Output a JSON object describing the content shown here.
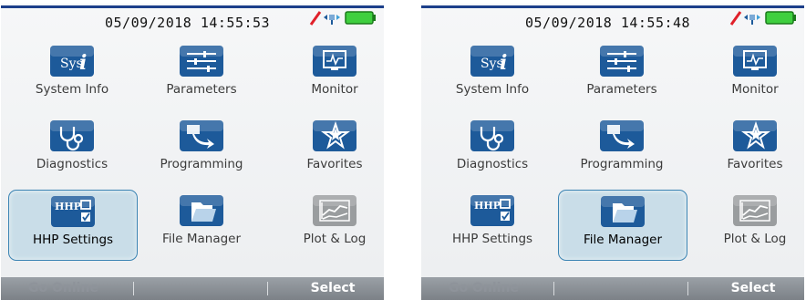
{
  "screens": [
    {
      "datetime": "05/09/2018  14:55:53",
      "selected_index": 6,
      "menu": [
        {
          "label": "System Info",
          "icon": "system-info-icon"
        },
        {
          "label": "Parameters",
          "icon": "parameters-icon"
        },
        {
          "label": "Monitor",
          "icon": "monitor-icon"
        },
        {
          "label": "Diagnostics",
          "icon": "diagnostics-icon"
        },
        {
          "label": "Programming",
          "icon": "programming-icon"
        },
        {
          "label": "Favorites",
          "icon": "favorites-icon"
        },
        {
          "label": "HHP Settings",
          "icon": "hhp-settings-icon"
        },
        {
          "label": "File Manager",
          "icon": "file-manager-icon"
        },
        {
          "label": "Plot & Log",
          "icon": "plot-log-icon"
        }
      ],
      "softkeys": {
        "left": "Go Online",
        "right": "Select"
      }
    },
    {
      "datetime": "05/09/2018  14:55:48",
      "selected_index": 7,
      "menu": [
        {
          "label": "System Info",
          "icon": "system-info-icon"
        },
        {
          "label": "Parameters",
          "icon": "parameters-icon"
        },
        {
          "label": "Monitor",
          "icon": "monitor-icon"
        },
        {
          "label": "Diagnostics",
          "icon": "diagnostics-icon"
        },
        {
          "label": "Programming",
          "icon": "programming-icon"
        },
        {
          "label": "Favorites",
          "icon": "favorites-icon"
        },
        {
          "label": "HHP Settings",
          "icon": "hhp-settings-icon"
        },
        {
          "label": "File Manager",
          "icon": "file-manager-icon"
        },
        {
          "label": "Plot & Log",
          "icon": "plot-log-icon"
        }
      ],
      "softkeys": {
        "left": "Go Online",
        "right": "Select"
      }
    }
  ],
  "icon_text": {
    "sys": "Sys",
    "hhp": "HHP"
  },
  "colors": {
    "icon_blue": "#1d5a9a",
    "icon_gray": "#9a9d9f",
    "selected_fill": "#c9dde8",
    "softkey_bar": "#8a8f95",
    "status_red": "#e0202a",
    "status_green": "#3fcf3f"
  }
}
